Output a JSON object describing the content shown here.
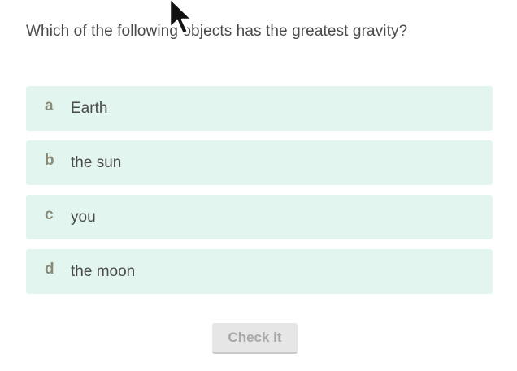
{
  "question": {
    "text": "Which of the following objects has the greatest gravity?"
  },
  "choices": [
    {
      "letter": "a",
      "label": "Earth"
    },
    {
      "letter": "b",
      "label": "the sun"
    },
    {
      "letter": "c",
      "label": "you"
    },
    {
      "letter": "d",
      "label": "the moon"
    }
  ],
  "actions": {
    "check_label": "Check it"
  },
  "colors": {
    "choice_background": "#e3f5ef",
    "letter": "#8a8a78",
    "text": "#4a4a4a",
    "button_disabled": "#e6e6e6"
  },
  "icons": {
    "cursor": "mouse-pointer-arrow-icon"
  }
}
